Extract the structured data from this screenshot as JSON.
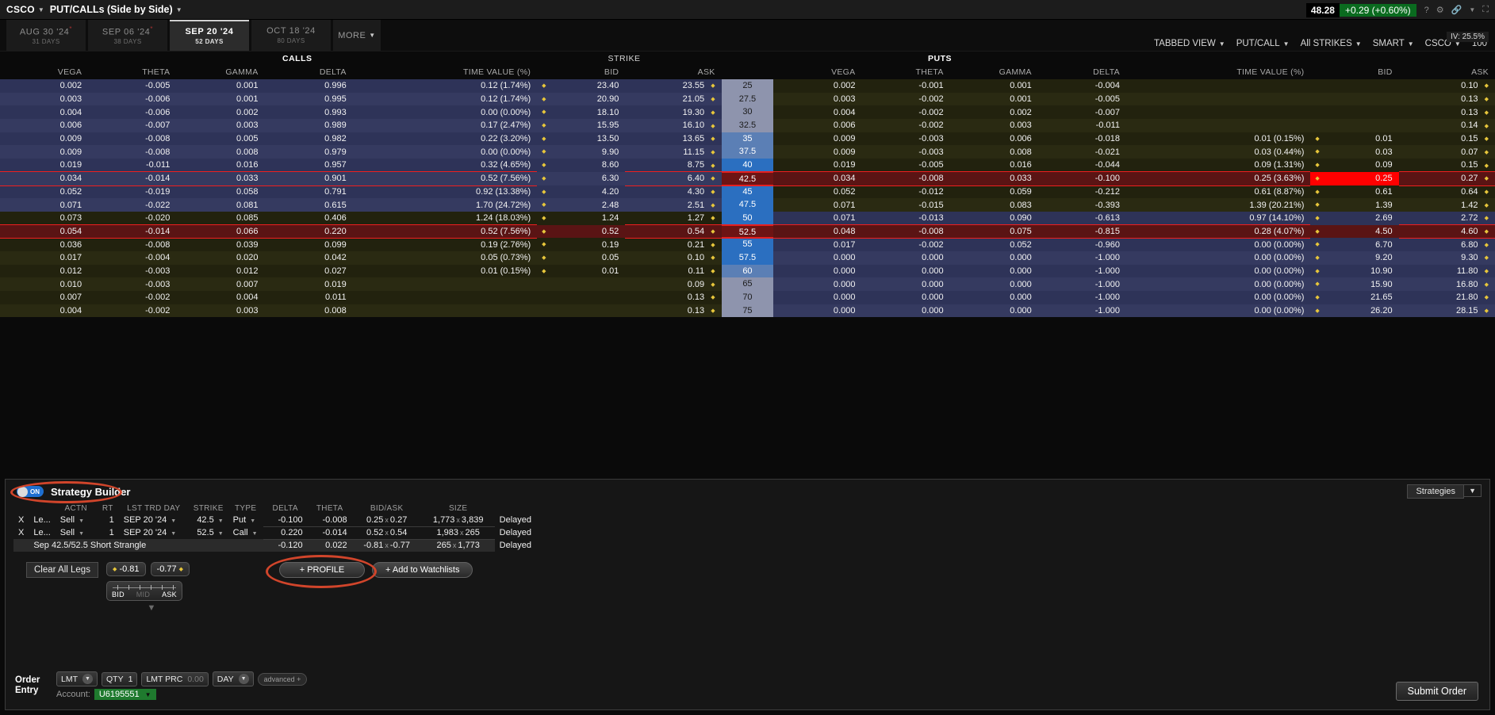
{
  "topbar": {
    "symbol": "CSCO",
    "view_title": "PUT/CALLs (Side by Side)",
    "last": "48.28",
    "change": "+0.29 (+0.60%)",
    "help_icon": "?",
    "gear_icon": "gear-icon",
    "link_icon": "link-icon",
    "expand_icon": "expand-icon"
  },
  "expiries": [
    {
      "date": "AUG 30 '24",
      "days": "31 DAYS",
      "active": false,
      "weekly": true
    },
    {
      "date": "SEP 06 '24",
      "days": "38 DAYS",
      "active": false,
      "weekly": true
    },
    {
      "date": "SEP 20 '24",
      "days": "52 DAYS",
      "active": true,
      "weekly": false
    },
    {
      "date": "OCT 18 '24",
      "days": "80 DAYS",
      "active": false,
      "weekly": false
    }
  ],
  "more_tab": "MORE",
  "view_options": [
    {
      "label": "TABBED VIEW",
      "caret": true
    },
    {
      "label": "PUT/CALL",
      "caret": true
    },
    {
      "label": "All STRIKES",
      "caret": true
    },
    {
      "label": "SMART",
      "caret": true
    },
    {
      "label": "CSCO",
      "caret": true
    },
    {
      "label": "100",
      "caret": false
    }
  ],
  "iv_badge": "IV: 25.5%",
  "chain": {
    "calls_title": "CALLS",
    "puts_title": "PUTS",
    "strike_title": "STRIKE",
    "columns": [
      "VEGA",
      "THETA",
      "GAMMA",
      "DELTA",
      "TIME VALUE (%)",
      "BID",
      "ASK"
    ],
    "rows": [
      {
        "strike": "25",
        "strike_style": "grey",
        "call": {
          "vega": "0.002",
          "theta": "-0.005",
          "gamma": "0.001",
          "delta": "0.996",
          "tv": "0.12 (1.74%)",
          "bid": "23.40",
          "ask": "23.55"
        },
        "put": {
          "vega": "0.002",
          "theta": "-0.001",
          "gamma": "0.001",
          "delta": "-0.004",
          "tv": "",
          "bid": "",
          "ask": "0.10"
        }
      },
      {
        "strike": "27.5",
        "strike_style": "grey",
        "call": {
          "vega": "0.003",
          "theta": "-0.006",
          "gamma": "0.001",
          "delta": "0.995",
          "tv": "0.12 (1.74%)",
          "bid": "20.90",
          "ask": "21.05"
        },
        "put": {
          "vega": "0.003",
          "theta": "-0.002",
          "gamma": "0.001",
          "delta": "-0.005",
          "tv": "",
          "bid": "",
          "ask": "0.13"
        }
      },
      {
        "strike": "30",
        "strike_style": "grey",
        "call": {
          "vega": "0.004",
          "theta": "-0.006",
          "gamma": "0.002",
          "delta": "0.993",
          "tv": "0.00 (0.00%)",
          "bid": "18.10",
          "ask": "19.30"
        },
        "put": {
          "vega": "0.004",
          "theta": "-0.002",
          "gamma": "0.002",
          "delta": "-0.007",
          "tv": "",
          "bid": "",
          "ask": "0.13"
        }
      },
      {
        "strike": "32.5",
        "strike_style": "grey",
        "call": {
          "vega": "0.006",
          "theta": "-0.007",
          "gamma": "0.003",
          "delta": "0.989",
          "tv": "0.17 (2.47%)",
          "bid": "15.95",
          "ask": "16.10"
        },
        "put": {
          "vega": "0.006",
          "theta": "-0.002",
          "gamma": "0.003",
          "delta": "-0.011",
          "tv": "",
          "bid": "",
          "ask": "0.14"
        }
      },
      {
        "strike": "35",
        "strike_style": "lblue",
        "call": {
          "vega": "0.009",
          "theta": "-0.008",
          "gamma": "0.005",
          "delta": "0.982",
          "tv": "0.22 (3.20%)",
          "bid": "13.50",
          "ask": "13.65"
        },
        "put": {
          "vega": "0.009",
          "theta": "-0.003",
          "gamma": "0.006",
          "delta": "-0.018",
          "tv": "0.01 (0.15%)",
          "bid": "0.01",
          "ask": "0.15"
        }
      },
      {
        "strike": "37.5",
        "strike_style": "lblue",
        "call": {
          "vega": "0.009",
          "theta": "-0.008",
          "gamma": "0.008",
          "delta": "0.979",
          "tv": "0.00 (0.00%)",
          "bid": "9.90",
          "ask": "11.15"
        },
        "put": {
          "vega": "0.009",
          "theta": "-0.003",
          "gamma": "0.008",
          "delta": "-0.021",
          "tv": "0.03 (0.44%)",
          "bid": "0.03",
          "ask": "0.07"
        }
      },
      {
        "strike": "40",
        "strike_style": "blue",
        "call": {
          "vega": "0.019",
          "theta": "-0.011",
          "gamma": "0.016",
          "delta": "0.957",
          "tv": "0.32 (4.65%)",
          "bid": "8.60",
          "ask": "8.75"
        },
        "put": {
          "vega": "0.019",
          "theta": "-0.005",
          "gamma": "0.016",
          "delta": "-0.044",
          "tv": "0.09 (1.31%)",
          "bid": "0.09",
          "ask": "0.15"
        }
      },
      {
        "strike": "42.5",
        "strike_style": "red",
        "put_highlight": true,
        "put_flash_bid": true,
        "call": {
          "vega": "0.034",
          "theta": "-0.014",
          "gamma": "0.033",
          "delta": "0.901",
          "tv": "0.52 (7.56%)",
          "bid": "6.30",
          "ask": "6.40"
        },
        "put": {
          "vega": "0.034",
          "theta": "-0.008",
          "gamma": "0.033",
          "delta": "-0.100",
          "tv": "0.25 (3.63%)",
          "bid": "0.25",
          "ask": "0.27"
        }
      },
      {
        "strike": "45",
        "strike_style": "blue",
        "call": {
          "vega": "0.052",
          "theta": "-0.019",
          "gamma": "0.058",
          "delta": "0.791",
          "tv": "0.92 (13.38%)",
          "bid": "4.20",
          "ask": "4.30"
        },
        "put": {
          "vega": "0.052",
          "theta": "-0.012",
          "gamma": "0.059",
          "delta": "-0.212",
          "tv": "0.61 (8.87%)",
          "bid": "0.61",
          "ask": "0.64"
        }
      },
      {
        "strike": "47.5",
        "strike_style": "blue",
        "call": {
          "vega": "0.071",
          "theta": "-0.022",
          "gamma": "0.081",
          "delta": "0.615",
          "tv": "1.70 (24.72%)",
          "bid": "2.48",
          "ask": "2.51"
        },
        "put": {
          "vega": "0.071",
          "theta": "-0.015",
          "gamma": "0.083",
          "delta": "-0.393",
          "tv": "1.39 (20.21%)",
          "bid": "1.39",
          "ask": "1.42"
        }
      },
      {
        "strike": "50",
        "strike_style": "blue",
        "call": {
          "vega": "0.073",
          "theta": "-0.020",
          "gamma": "0.085",
          "delta": "0.406",
          "tv": "1.24 (18.03%)",
          "bid": "1.24",
          "ask": "1.27"
        },
        "put": {
          "vega": "0.071",
          "theta": "-0.013",
          "gamma": "0.090",
          "delta": "-0.613",
          "tv": "0.97 (14.10%)",
          "bid": "2.69",
          "ask": "2.72"
        }
      },
      {
        "strike": "52.5",
        "strike_style": "red",
        "call_highlight": true,
        "call_flash_bid": true,
        "call": {
          "vega": "0.054",
          "theta": "-0.014",
          "gamma": "0.066",
          "delta": "0.220",
          "tv": "0.52 (7.56%)",
          "bid": "0.52",
          "ask": "0.54"
        },
        "put": {
          "vega": "0.048",
          "theta": "-0.008",
          "gamma": "0.075",
          "delta": "-0.815",
          "tv": "0.28 (4.07%)",
          "bid": "4.50",
          "ask": "4.60"
        }
      },
      {
        "strike": "55",
        "strike_style": "blue",
        "call": {
          "vega": "0.036",
          "theta": "-0.008",
          "gamma": "0.039",
          "delta": "0.099",
          "tv": "0.19 (2.76%)",
          "bid": "0.19",
          "ask": "0.21"
        },
        "put": {
          "vega": "0.017",
          "theta": "-0.002",
          "gamma": "0.052",
          "delta": "-0.960",
          "tv": "0.00 (0.00%)",
          "bid": "6.70",
          "ask": "6.80"
        }
      },
      {
        "strike": "57.5",
        "strike_style": "blue",
        "call": {
          "vega": "0.017",
          "theta": "-0.004",
          "gamma": "0.020",
          "delta": "0.042",
          "tv": "0.05 (0.73%)",
          "bid": "0.05",
          "ask": "0.10"
        },
        "put": {
          "vega": "0.000",
          "theta": "0.000",
          "gamma": "0.000",
          "delta": "-1.000",
          "tv": "0.00 (0.00%)",
          "bid": "9.20",
          "ask": "9.30"
        }
      },
      {
        "strike": "60",
        "strike_style": "lblue",
        "call": {
          "vega": "0.012",
          "theta": "-0.003",
          "gamma": "0.012",
          "delta": "0.027",
          "tv": "0.01 (0.15%)",
          "bid": "0.01",
          "ask": "0.11"
        },
        "put": {
          "vega": "0.000",
          "theta": "0.000",
          "gamma": "0.000",
          "delta": "-1.000",
          "tv": "0.00 (0.00%)",
          "bid": "10.90",
          "ask": "11.80"
        }
      },
      {
        "strike": "65",
        "strike_style": "grey",
        "call": {
          "vega": "0.010",
          "theta": "-0.003",
          "gamma": "0.007",
          "delta": "0.019",
          "tv": "",
          "bid": "",
          "ask": "0.09"
        },
        "put": {
          "vega": "0.000",
          "theta": "0.000",
          "gamma": "0.000",
          "delta": "-1.000",
          "tv": "0.00 (0.00%)",
          "bid": "15.90",
          "ask": "16.80"
        }
      },
      {
        "strike": "70",
        "strike_style": "grey",
        "call": {
          "vega": "0.007",
          "theta": "-0.002",
          "gamma": "0.004",
          "delta": "0.011",
          "tv": "",
          "bid": "",
          "ask": "0.13"
        },
        "put": {
          "vega": "0.000",
          "theta": "0.000",
          "gamma": "0.000",
          "delta": "-1.000",
          "tv": "0.00 (0.00%)",
          "bid": "21.65",
          "ask": "21.80"
        }
      },
      {
        "strike": "75",
        "strike_style": "grey",
        "call": {
          "vega": "0.004",
          "theta": "-0.002",
          "gamma": "0.003",
          "delta": "0.008",
          "tv": "",
          "bid": "",
          "ask": "0.13"
        },
        "put": {
          "vega": "0.000",
          "theta": "0.000",
          "gamma": "0.000",
          "delta": "-1.000",
          "tv": "0.00 (0.00%)",
          "bid": "26.20",
          "ask": "28.15"
        }
      }
    ]
  },
  "strategy_builder": {
    "title": "Strategy Builder",
    "toggle_state": "ON",
    "strategies_button": "Strategies",
    "legs_columns": [
      "ACTN",
      "RT",
      "LST TRD DAY",
      "STRIKE",
      "TYPE",
      "DELTA",
      "THETA",
      "BID/ASK",
      "SIZE"
    ],
    "legs": [
      {
        "remove": "X",
        "leg": "Le...",
        "actn": "Sell",
        "rt": "1",
        "day": "SEP 20 '24",
        "strike": "42.5",
        "type": "Put",
        "delta": "-0.100",
        "theta": "-0.008",
        "bid": "0.25",
        "ask": "0.27",
        "size_a": "1,773",
        "size_b": "3,839",
        "status": "Delayed"
      },
      {
        "remove": "X",
        "leg": "Le...",
        "actn": "Sell",
        "rt": "1",
        "day": "SEP 20 '24",
        "strike": "52.5",
        "type": "Call",
        "delta": "0.220",
        "theta": "-0.014",
        "bid": "0.52",
        "ask": "0.54",
        "size_a": "1,983",
        "size_b": "265",
        "status": "Delayed"
      }
    ],
    "total": {
      "name": "Sep 42.5/52.5 Short Strangle",
      "delta": "-0.120",
      "theta": "0.022",
      "bid": "-0.81",
      "ask": "-0.77",
      "size_a": "265",
      "size_b": "1,773",
      "status": "Delayed"
    },
    "clear_all_legs": "Clear All Legs",
    "profile_button": "+ PROFILE",
    "add_watchlist_button": "+ Add to Watchlists"
  },
  "ladder": {
    "bid_price": "-0.81",
    "ask_price": "-0.77",
    "bid_label": "BID",
    "mid_label": "MID",
    "ask_label": "ASK"
  },
  "order_entry": {
    "label_line1": "Order",
    "label_line2": "Entry",
    "order_type": "LMT",
    "qty_label": "QTY",
    "qty_value": "1",
    "lmt_prc_label": "LMT PRC",
    "lmt_prc_value": "0.00",
    "tif": "DAY",
    "advanced": "advanced",
    "advanced_plus": "+",
    "account_label": "Account:",
    "account_value": "U6195551",
    "submit_button": "Submit Order"
  }
}
